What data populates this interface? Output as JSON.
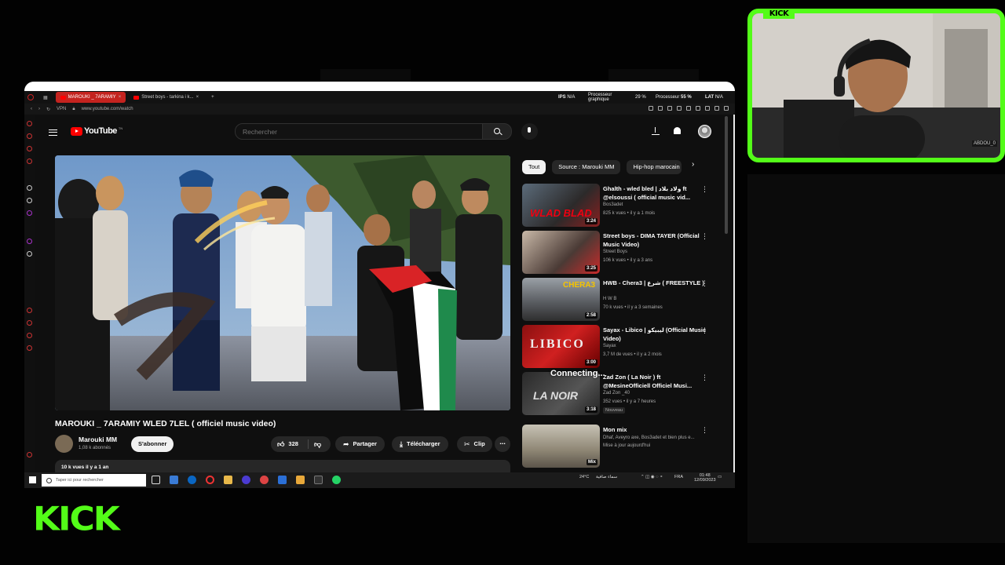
{
  "browser": {
    "tabs": [
      {
        "label": "MAROUKI _ 7ARAMIY",
        "active": true
      },
      {
        "label": "Street boys - tarkina i k...",
        "active": false
      }
    ],
    "url": "www.youtube.com/watch",
    "sysinfo": {
      "ips": "IPS",
      "ips_value": "N/A",
      "gpu_label": "Processeur graphique",
      "gpu_value": "29 %",
      "cpu_label": "Processeur",
      "cpu_value": "55 %",
      "lat": "LAT",
      "lat_value": "N/A"
    }
  },
  "youtube": {
    "logo_text": "YouTube",
    "logo_country": "TN",
    "search_placeholder": "Rechercher",
    "video": {
      "title": "MAROUKI _ 7ARAMIY WLED 7LEL ( officiel music video)",
      "channel": "Marouki MM",
      "subscribers": "1,08 k abonnés",
      "subscribe_label": "S'abonner",
      "likes": "328",
      "share_label": "Partager",
      "download_label": "Télécharger",
      "clip_label": "Clip",
      "description": "10 k vues  il y a 1 an"
    },
    "chips": [
      "Tout",
      "Source : Marouki MM",
      "Hip-hop marocain"
    ],
    "recommendations": [
      {
        "title": "Ghalth - wled bled | ولاد بلاد ft @elsoussi ( official music vid...",
        "channel": "Bos3adet",
        "meta": "825 k vues • il y a 1 mois",
        "duration": "3:24",
        "badge": ""
      },
      {
        "title": "Street boys - DIMA TAYER (Official Music Video)",
        "channel": "Street Boys",
        "meta": "106 k vues • il y a 3 ans",
        "duration": "3:25",
        "badge": ""
      },
      {
        "title": "HWB - Chera3 | شرع ( FREESTYLE )",
        "channel": "H W B",
        "meta": "70 k vues • il y a 3 semaines",
        "duration": "2:58",
        "badge": ""
      },
      {
        "title": "Sayax - Libico | ليبيكو (Official Music Video)",
        "channel": "Sayax",
        "meta": "3,7 M de vues • il y a 2 mois",
        "duration": "3:00",
        "badge": ""
      },
      {
        "title": "Zad Zon ( La Noir ) ft @MesineOfficiell Officiel Musi...",
        "channel": "Zad Zon _40",
        "meta": "352 vues • il y a 7 heures",
        "duration": "3:18",
        "badge": "Nouveau"
      },
      {
        "title": "Mon mix",
        "channel": "Dhaf, Aveyro axe, Bos3adet et bien plus e...",
        "meta": "Mise à jour aujourd'hui",
        "duration": "Mix",
        "badge": ""
      }
    ],
    "connecting_text": "Connecting..."
  },
  "taskbar": {
    "search_placeholder": "Taper ici pour rechercher",
    "weather": "24°C",
    "weather_desc": "سماء صافية",
    "lang": "FRA",
    "time": "01:48",
    "date": "12/09/2023"
  },
  "webcam": {
    "tag": "KICK",
    "label": "ABDOU_0"
  },
  "brand": {
    "logo": "KICK",
    "color": "#53fc18"
  }
}
